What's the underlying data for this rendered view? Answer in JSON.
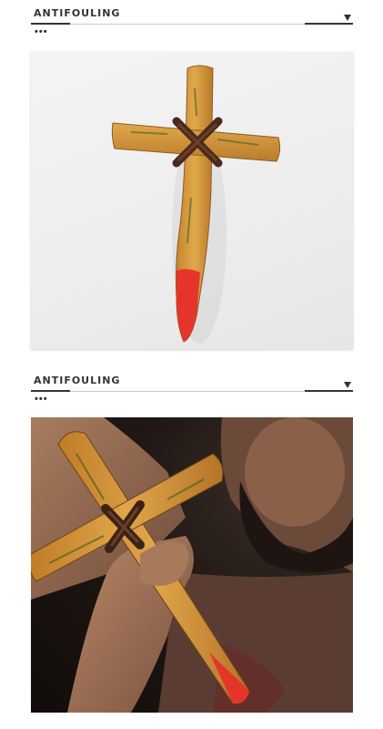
{
  "sections": [
    {
      "title": "ANTIFOULING",
      "dots": "•••"
    },
    {
      "title": "ANTIFOULING",
      "dots": "•••"
    }
  ],
  "colors": {
    "wood": "#d39a3f",
    "wood_dark": "#8c5a22",
    "moss": "#5a6a2c",
    "binding": "#4a2a1c",
    "tip_red": "#e5352a",
    "text": "#333333"
  }
}
